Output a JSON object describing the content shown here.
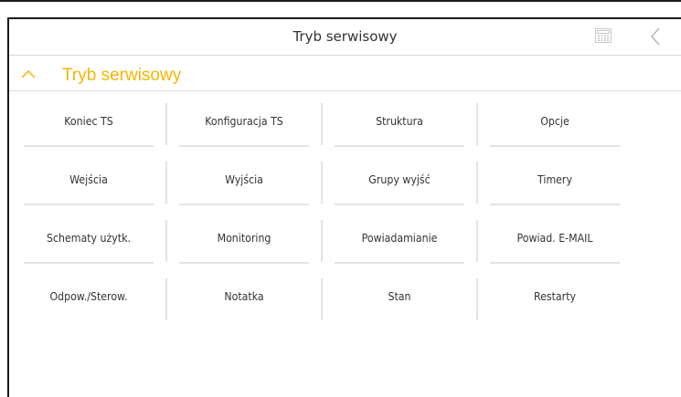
{
  "header": {
    "title": "Tryb serwisowy",
    "keypad_icon": "keypad-icon",
    "back_icon": "chevron-left-icon"
  },
  "section": {
    "title": "Tryb serwisowy",
    "expanded": true,
    "accent_color": "#f5b600"
  },
  "menu": {
    "rows": [
      [
        "Koniec TS",
        "Konfiguracja TS",
        "Struktura",
        "Opcje"
      ],
      [
        "Wejścia",
        "Wyjścia",
        "Grupy wyjść",
        "Timery"
      ],
      [
        "Schematy użytk.",
        "Monitoring",
        "Powiadamianie",
        "Powiad. E-MAIL"
      ],
      [
        "Odpow./Sterow.",
        "Notatka",
        "Stan",
        "Restarty"
      ]
    ]
  }
}
